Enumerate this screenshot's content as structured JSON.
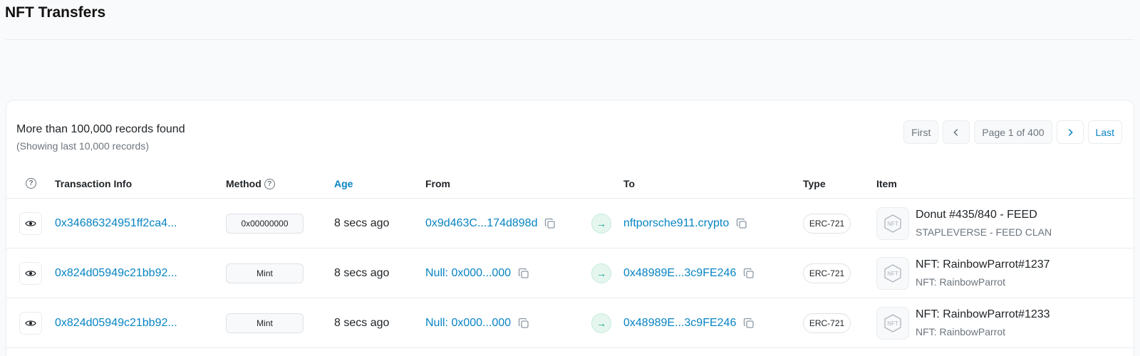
{
  "page": {
    "title": "NFT Transfers"
  },
  "summary": {
    "records_found": "More than 100,000 records found",
    "records_note": "(Showing last 10,000 records)"
  },
  "pagination": {
    "first": "First",
    "page_label": "Page 1 of 400",
    "last": "Last"
  },
  "table": {
    "headers": {
      "info_icon": "question-circle-icon",
      "transaction_info": "Transaction Info",
      "method": "Method",
      "age": "Age",
      "from": "From",
      "to": "To",
      "type": "Type",
      "item": "Item"
    },
    "rows": [
      {
        "tx_hash": "0x34686324951ff2ca4...",
        "method": "0x00000000",
        "age": "8 secs ago",
        "from": "0x9d463C...174d898d",
        "to": "nftporsche911.crypto",
        "type": "ERC-721",
        "item_name": "Donut #435/840 - FEED",
        "item_collection": "STAPLEVERSE - FEED CLAN"
      },
      {
        "tx_hash": "0x824d05949c21bb92...",
        "method": "Mint",
        "age": "8 secs ago",
        "from": "Null: 0x000...000",
        "to": "0x48989E...3c9FE246",
        "type": "ERC-721",
        "item_name": "NFT: RainbowParrot#1237",
        "item_collection": "NFT: RainbowParrot"
      },
      {
        "tx_hash": "0x824d05949c21bb92...",
        "method": "Mint",
        "age": "8 secs ago",
        "from": "Null: 0x000...000",
        "to": "0x48989E...3c9FE246",
        "type": "ERC-721",
        "item_name": "NFT: RainbowParrot#1233",
        "item_collection": "NFT: RainbowParrot"
      }
    ]
  },
  "colors": {
    "link": "#0784c3",
    "direction_green": "#00a186",
    "muted": "#6c757d"
  }
}
